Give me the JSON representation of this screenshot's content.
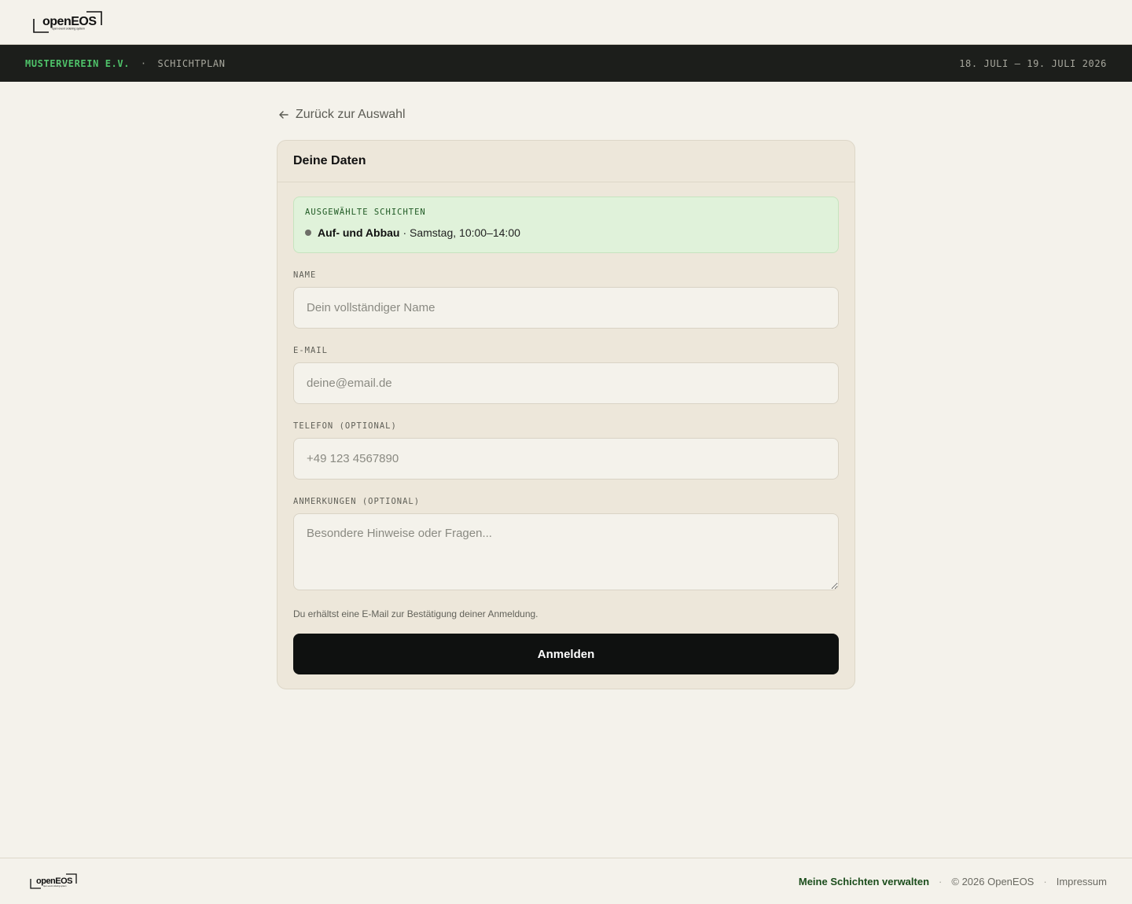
{
  "brand": {
    "logo_text": "openEOS",
    "logo_tagline": "open event ordering system"
  },
  "subheader": {
    "org_name": "MUSTERVEREIN E.V.",
    "separator": "·",
    "section": "SCHICHTPLAN",
    "date_range": "18. JULI – 19. JULI 2026"
  },
  "back_link": {
    "icon": "arrow-left-icon",
    "label": "Zurück zur Auswahl"
  },
  "form": {
    "title": "Deine Daten",
    "selected": {
      "label": "AUSGEWÄHLTE SCHICHTEN",
      "shifts": [
        {
          "name": "Auf- und Abbau",
          "detail": "· Samstag, 10:00–14:00"
        }
      ]
    },
    "fields": {
      "name": {
        "label": "NAME",
        "value": "",
        "placeholder": "Dein vollständiger Name"
      },
      "email": {
        "label": "E-MAIL",
        "value": "",
        "placeholder": "deine@email.de"
      },
      "phone": {
        "label": "TELEFON (OPTIONAL)",
        "value": "",
        "placeholder": "+49 123 4567890"
      },
      "notes": {
        "label": "ANMERKUNGEN (OPTIONAL)",
        "value": "",
        "placeholder": "Besondere Hinweise oder Fragen..."
      }
    },
    "hint": "Du erhältst eine E-Mail zur Bestätigung deiner Anmeldung.",
    "submit_label": "Anmelden"
  },
  "footer": {
    "manage_link": "Meine Schichten verwalten",
    "separator": "·",
    "copyright": "© 2026 OpenEOS",
    "impressum": "Impressum"
  },
  "colors": {
    "background": "#f4f2eb",
    "subbar": "#1c1e1b",
    "accent_green": "#4fc36a",
    "card": "#ede7da",
    "selected_box": "#e0f2da",
    "button": "#0f1110",
    "link_green": "#1b4d1c"
  }
}
